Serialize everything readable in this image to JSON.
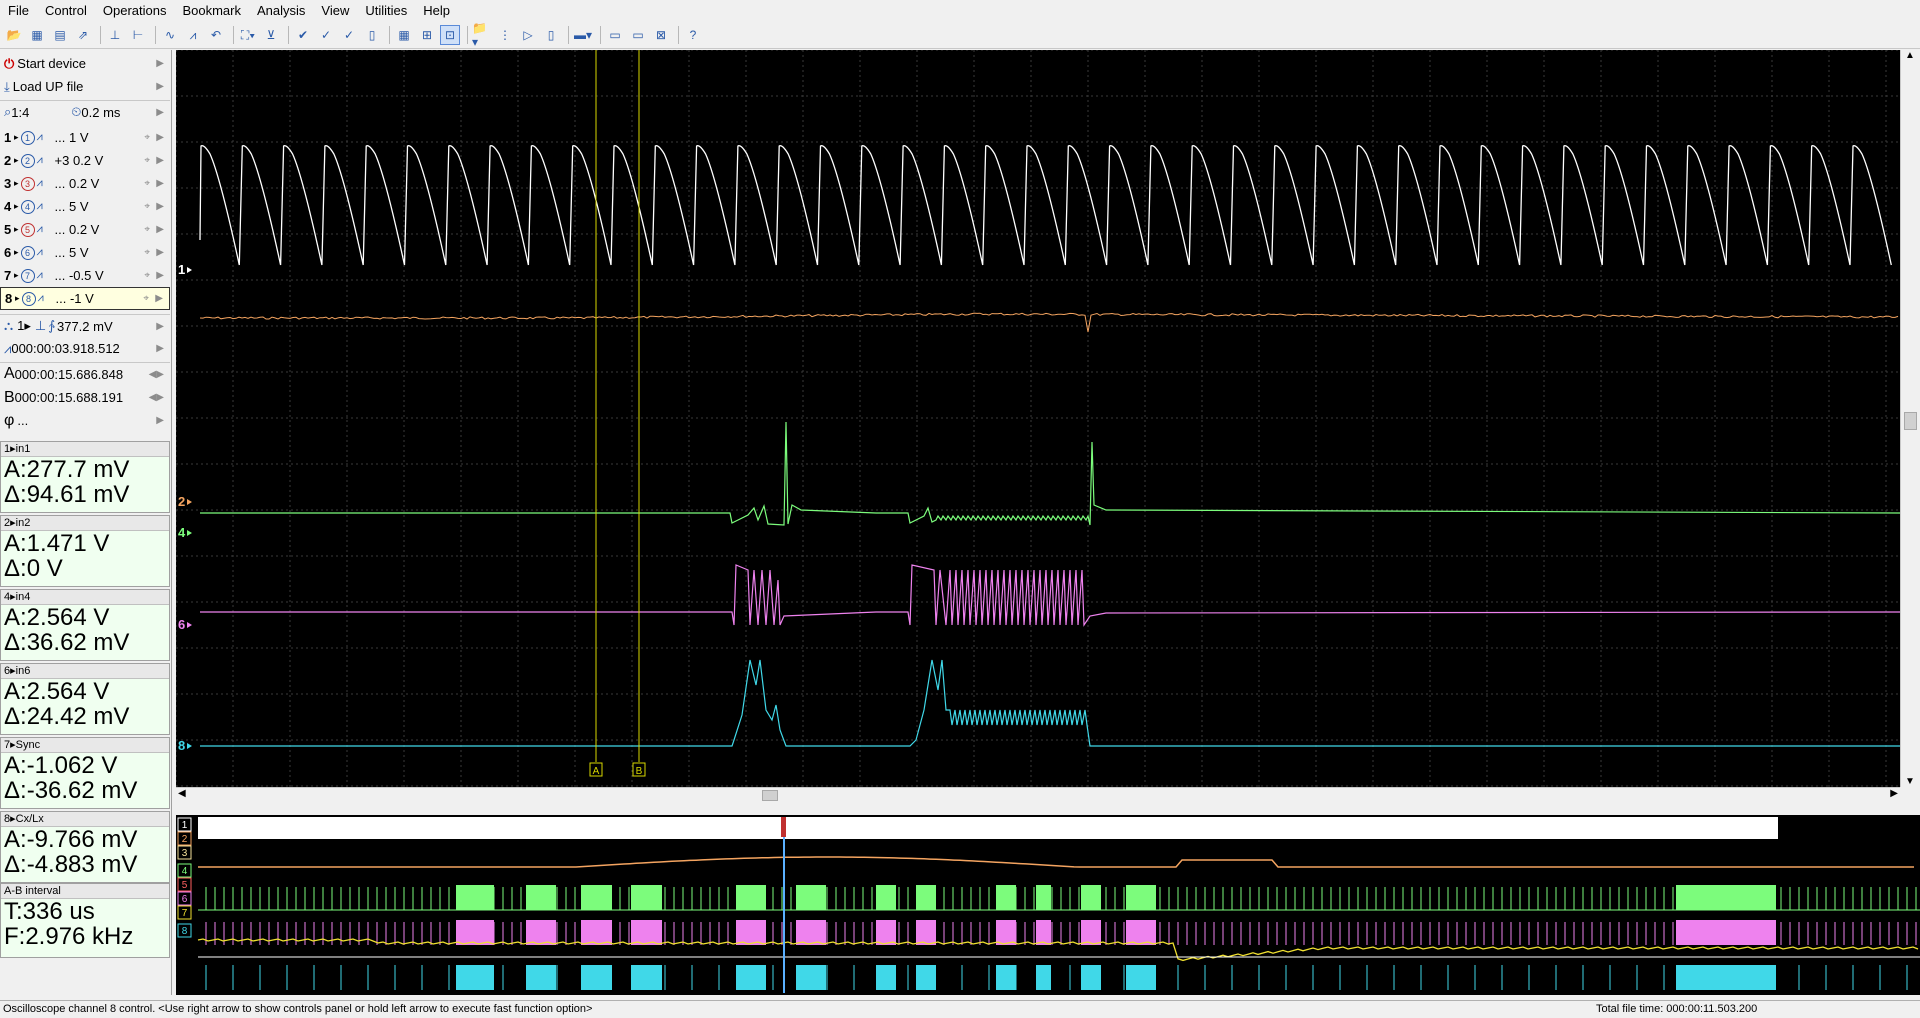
{
  "menu": [
    "File",
    "Control",
    "Operations",
    "Bookmark",
    "Analysis",
    "View",
    "Utilities",
    "Help"
  ],
  "left": {
    "start_device": "Start device",
    "load_up": "Load UP file",
    "zoom": "1:4",
    "timebase": "0.2 ms",
    "channels": [
      {
        "num": "1",
        "circle": "1",
        "scale": "... 1 V",
        "on": true
      },
      {
        "num": "2",
        "circle": "2",
        "scale": "+3 0.2 V",
        "on": true
      },
      {
        "num": "3",
        "circle": "3",
        "scale": "... 0.2 V",
        "on": false
      },
      {
        "num": "4",
        "circle": "4",
        "scale": "... 5 V",
        "on": true
      },
      {
        "num": "5",
        "circle": "5",
        "scale": "... 0.2 V",
        "on": false
      },
      {
        "num": "6",
        "circle": "6",
        "scale": "... 5 V",
        "on": true
      },
      {
        "num": "7",
        "circle": "7",
        "scale": "... -0.5 V",
        "on": true
      },
      {
        "num": "8",
        "circle": "8",
        "scale": "... -1 V",
        "on": true
      }
    ],
    "trigger_level": "377.2 mV",
    "trigger_time": "000:00:03.918.512",
    "cursor_a": "000:00:15.686.848",
    "cursor_b": "000:00:15.688.191",
    "phi": "...",
    "measurements": [
      {
        "head": "in1",
        "chan": "1",
        "a": "A:277.7 mV",
        "d": "Δ:94.61 mV"
      },
      {
        "head": "in2",
        "chan": "2",
        "a": "A:1.471 V",
        "d": "Δ:0 V"
      },
      {
        "head": "in4",
        "chan": "4",
        "a": "A:2.564 V",
        "d": "Δ:36.62 mV"
      },
      {
        "head": "in6",
        "chan": "6",
        "a": "A:2.564 V",
        "d": "Δ:24.42 mV"
      },
      {
        "head": "Sync",
        "chan": "7",
        "a": "A:-1.062 V",
        "d": "Δ:-36.62 mV"
      },
      {
        "head": "Cx/Lx",
        "chan": "8",
        "a": "A:-9.766 mV",
        "d": "Δ:-4.883 mV"
      }
    ],
    "interval": {
      "head": "A-B interval",
      "t": "T:336 us",
      "f": "F:2.976 kHz"
    }
  },
  "scope": {
    "channel_markers": [
      "1",
      "2",
      "4",
      "6",
      "8"
    ],
    "cursor_labels": [
      "A",
      "B"
    ],
    "colors": {
      "ch1": "#ffffff",
      "ch2": "#f4a460",
      "ch4": "#7cfc7c",
      "ch6": "#ee82ee",
      "ch8": "#40d8e8",
      "ch7": "#f0e030",
      "cursor": "#d8d800"
    }
  },
  "overview": {
    "channel_labels": [
      "1",
      "2",
      "3",
      "4",
      "5",
      "6",
      "7",
      "8"
    ]
  },
  "status": {
    "message": "Oscilloscope channel 8 control. <Use right arrow to show controls panel or hold left arrow to execute fast function option>",
    "total_time": "Total file time: 000:00:11.503.200"
  }
}
